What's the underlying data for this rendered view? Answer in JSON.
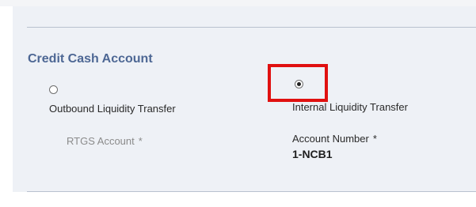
{
  "section": {
    "title": "Credit Cash Account"
  },
  "options": [
    {
      "label": "Outbound Liquidity Transfer",
      "selected": false
    },
    {
      "label": "Internal Liquidity Transfer",
      "selected": true
    }
  ],
  "fields": {
    "rtgs_account": {
      "label": "RTGS Account",
      "required_marker": "*"
    },
    "account_number": {
      "label": "Account Number",
      "required_marker": "*",
      "value": "1-NCB1"
    }
  },
  "highlight": {
    "color": "#e01010",
    "target": "internal-liquidity-transfer-radio"
  },
  "colors": {
    "panel_background": "#eef1f6",
    "section_title": "#4d6794",
    "divider": "#b9c1cf",
    "muted_label": "#8b8b8b"
  }
}
